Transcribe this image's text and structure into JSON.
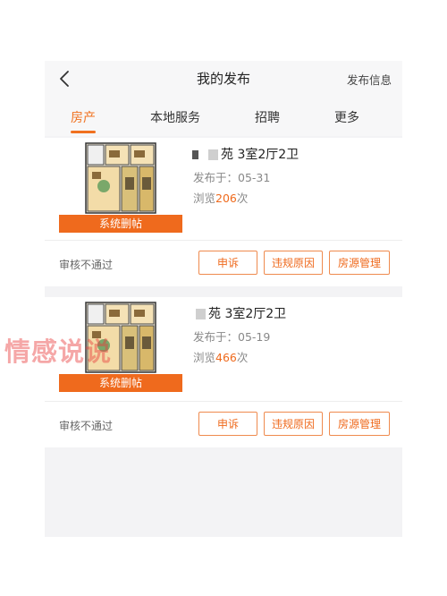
{
  "header": {
    "title": "我的发布",
    "action": "发布信息"
  },
  "tabs": [
    {
      "label": "房产",
      "active": true
    },
    {
      "label": "本地服务",
      "active": false
    },
    {
      "label": "招聘",
      "active": false
    },
    {
      "label": "更多",
      "active": false
    }
  ],
  "listings": [
    {
      "title": "苑 3室2厅2卫",
      "publish_date": "发布于：05-31",
      "views_prefix": "浏览",
      "views_count": "206",
      "views_suffix": "次",
      "banner": "系统删帖",
      "status": "审核不通过",
      "buttons": {
        "appeal": "申诉",
        "reason": "违规原因",
        "manage": "房源管理"
      }
    },
    {
      "title": "苑 3室2厅2卫",
      "publish_date": "发布于：05-19",
      "views_prefix": "浏览",
      "views_count": "466",
      "views_suffix": "次",
      "banner": "系统删帖",
      "status": "审核不通过",
      "buttons": {
        "appeal": "申诉",
        "reason": "违规原因",
        "manage": "房源管理"
      }
    }
  ],
  "watermark": "情感说说",
  "colors": {
    "accent": "#ef6a1d",
    "background": "#f3f3f5"
  },
  "icons": {
    "back": "chevron-left-icon"
  }
}
